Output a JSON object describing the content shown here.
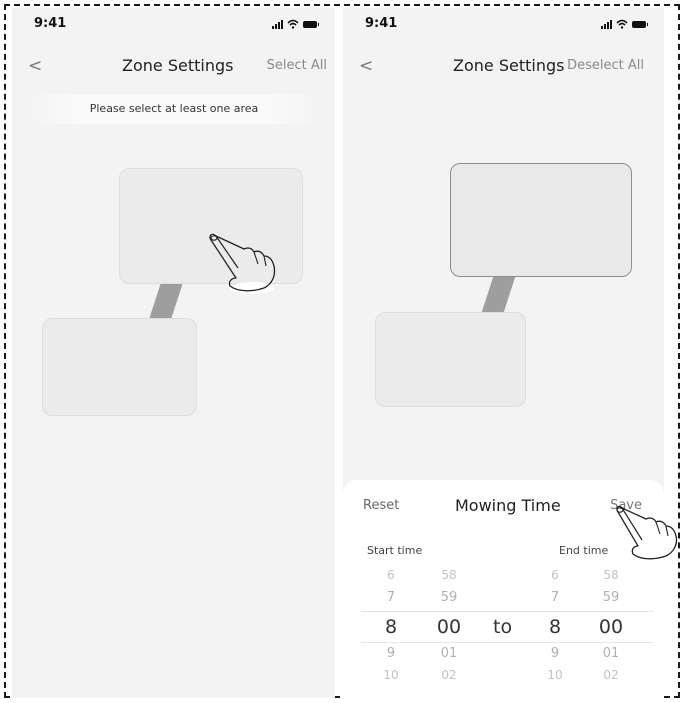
{
  "left": {
    "status": {
      "time": "9:41"
    },
    "nav": {
      "back": "<",
      "title": "Zone Settings",
      "action": "Select All"
    },
    "banner": "Please select at least one area"
  },
  "right": {
    "status": {
      "time": "9:41"
    },
    "nav": {
      "back": "<",
      "title": "Zone Settings",
      "action": "Deselect All"
    },
    "sheet": {
      "reset": "Reset",
      "title": "Mowing Time",
      "save": "Save",
      "start_label": "Start time",
      "end_label": "End time",
      "to": "to",
      "start_hours": [
        "6",
        "7",
        "8",
        "9",
        "10"
      ],
      "start_minutes": [
        "58",
        "59",
        "00",
        "01",
        "02"
      ],
      "end_hours": [
        "6",
        "7",
        "8",
        "9",
        "10"
      ],
      "end_minutes": [
        "58",
        "59",
        "00",
        "01",
        "02"
      ]
    }
  },
  "colors": {
    "screen_bg": "#f3f3f3",
    "zone_fill": "#ebebeb",
    "connector": "#9e9e9e",
    "selected_zone_border": "#8d8d8d"
  },
  "icons": [
    "signal-icon",
    "wifi-icon",
    "battery-icon",
    "back-icon",
    "hand-pointer-icon"
  ]
}
